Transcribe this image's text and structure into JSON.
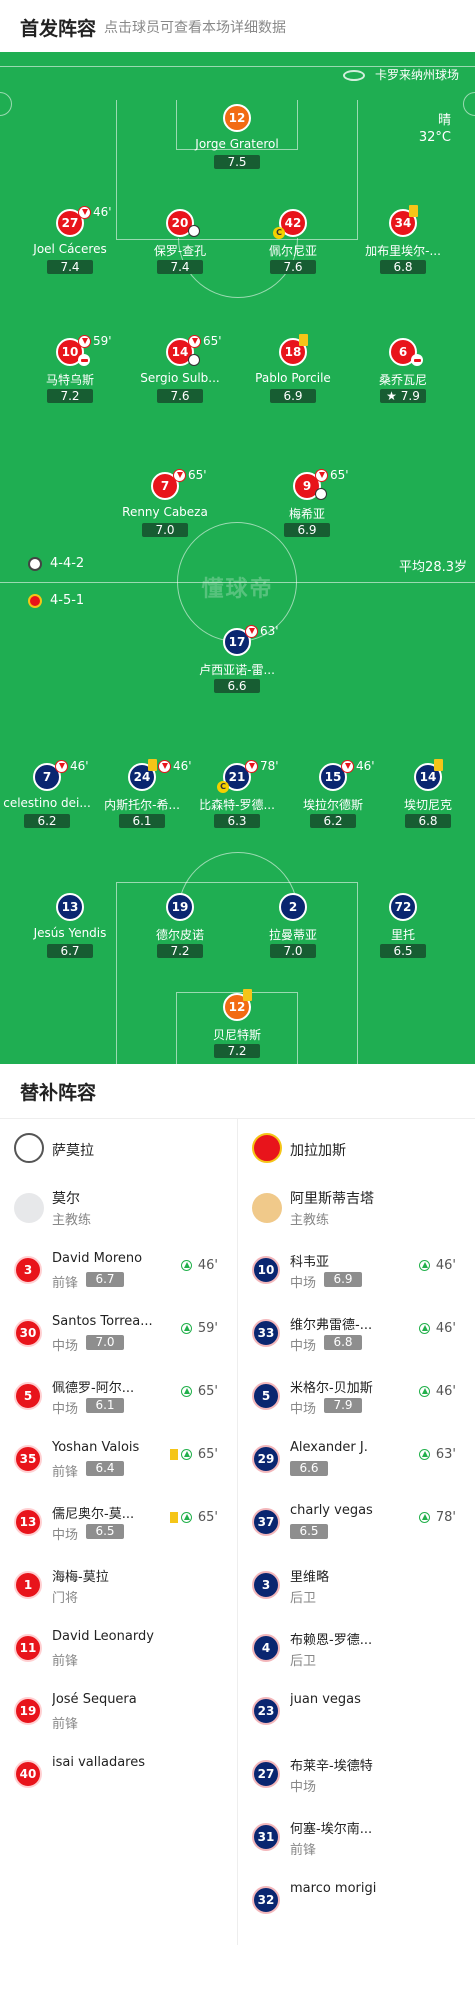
{
  "header": {
    "title": "首发阵容",
    "subtitle": "点击球员可查看本场详细数据"
  },
  "pitch": {
    "venue": "卡罗来纳州球场",
    "weather": "晴",
    "temp": "32°C",
    "watermark": "懂球帝",
    "home_formation": "4-4-2",
    "away_formation": "4-5-1",
    "avg_age": "平均28.3岁"
  },
  "home": [
    {
      "n": "12",
      "name": "Jorge Graterol",
      "r": "7.5"
    },
    {
      "n": "27",
      "name": "Joel Cáceres",
      "r": "7.4",
      "sub": "46'"
    },
    {
      "n": "20",
      "name": "保罗-查孔",
      "r": "7.4"
    },
    {
      "n": "42",
      "name": "佩尔尼亚",
      "r": "7.6"
    },
    {
      "n": "34",
      "name": "加布里埃尔-...",
      "r": "6.8"
    },
    {
      "n": "10",
      "name": "马特乌斯",
      "r": "7.2",
      "sub": "59'"
    },
    {
      "n": "14",
      "name": "Sergio Sulb...",
      "r": "7.6",
      "sub": "65'"
    },
    {
      "n": "18",
      "name": "Pablo Porcile",
      "r": "6.9"
    },
    {
      "n": "6",
      "name": "桑乔瓦尼",
      "r": "7.9"
    },
    {
      "n": "7",
      "name": "Renny Cabeza",
      "r": "7.0",
      "sub": "65'"
    },
    {
      "n": "9",
      "name": "梅希亚",
      "r": "6.9",
      "sub": "65'"
    }
  ],
  "away": [
    {
      "n": "17",
      "name": "卢西亚诺-雷...",
      "r": "6.6",
      "sub": "63'"
    },
    {
      "n": "7",
      "name": "celestino dei...",
      "r": "6.2",
      "sub": "46'"
    },
    {
      "n": "24",
      "name": "内斯托尔-希...",
      "r": "6.1",
      "sub": "46'"
    },
    {
      "n": "21",
      "name": "比森特-罗德...",
      "r": "6.3",
      "sub": "78'"
    },
    {
      "n": "15",
      "name": "埃拉尔德斯",
      "r": "6.2",
      "sub": "46'"
    },
    {
      "n": "14",
      "name": "埃切尼克",
      "r": "6.8"
    },
    {
      "n": "13",
      "name": "Jesús Yendis",
      "r": "6.7"
    },
    {
      "n": "19",
      "name": "德尔皮诺",
      "r": "7.2"
    },
    {
      "n": "2",
      "name": "拉曼蒂亚",
      "r": "7.0"
    },
    {
      "n": "72",
      "name": "里托",
      "r": "6.5"
    },
    {
      "n": "12",
      "name": "贝尼特斯",
      "r": "7.2"
    }
  ],
  "bench": {
    "title": "替补阵容",
    "home_team": "萨莫拉",
    "away_team": "加拉加斯",
    "home_coach": {
      "name": "莫尔",
      "role": "主教练"
    },
    "away_coach": {
      "name": "阿里斯蒂吉塔",
      "role": "主教练"
    },
    "home_subs": [
      {
        "n": "3",
        "name": "David Moreno",
        "pos": "前锋",
        "r": "6.7",
        "t": "46'"
      },
      {
        "n": "30",
        "name": "Santos Torrea...",
        "pos": "中场",
        "r": "7.0",
        "t": "59'"
      },
      {
        "n": "5",
        "name": "佩德罗-阿尔...",
        "pos": "中场",
        "r": "6.1",
        "t": "65'"
      },
      {
        "n": "35",
        "name": "Yoshan Valois",
        "pos": "前锋",
        "r": "6.4",
        "t": "65'"
      },
      {
        "n": "13",
        "name": "儒尼奥尔-莫...",
        "pos": "中场",
        "r": "6.5",
        "t": "65'"
      },
      {
        "n": "1",
        "name": "海梅-莫拉",
        "pos": "门将"
      },
      {
        "n": "11",
        "name": "David Leonardy",
        "pos": "前锋"
      },
      {
        "n": "19",
        "name": "José Sequera",
        "pos": "前锋"
      },
      {
        "n": "40",
        "name": "isai valladares"
      }
    ],
    "away_subs": [
      {
        "n": "10",
        "name": "科韦亚",
        "pos": "中场",
        "r": "6.9",
        "t": "46'"
      },
      {
        "n": "33",
        "name": "维尔弗雷德-...",
        "pos": "中场",
        "r": "6.8",
        "t": "46'"
      },
      {
        "n": "5",
        "name": "米格尔-贝加斯",
        "pos": "中场",
        "r": "7.9",
        "t": "46'"
      },
      {
        "n": "29",
        "name": "Alexander J.",
        "r": "6.6",
        "t": "63'"
      },
      {
        "n": "37",
        "name": "charly vegas",
        "r": "6.5",
        "t": "78'"
      },
      {
        "n": "3",
        "name": "里维略",
        "pos": "后卫"
      },
      {
        "n": "4",
        "name": "布赖恩-罗德...",
        "pos": "后卫"
      },
      {
        "n": "23",
        "name": "juan vegas"
      },
      {
        "n": "27",
        "name": "布莱辛-埃德特",
        "pos": "中场"
      },
      {
        "n": "31",
        "name": "何塞-埃尔南...",
        "pos": "前锋"
      },
      {
        "n": "32",
        "name": "marco morigi"
      }
    ]
  },
  "colors": {
    "pitch": "#1fae52",
    "home": "#e8141b",
    "home_gk": "#f26b13",
    "away": "#0a2670"
  }
}
